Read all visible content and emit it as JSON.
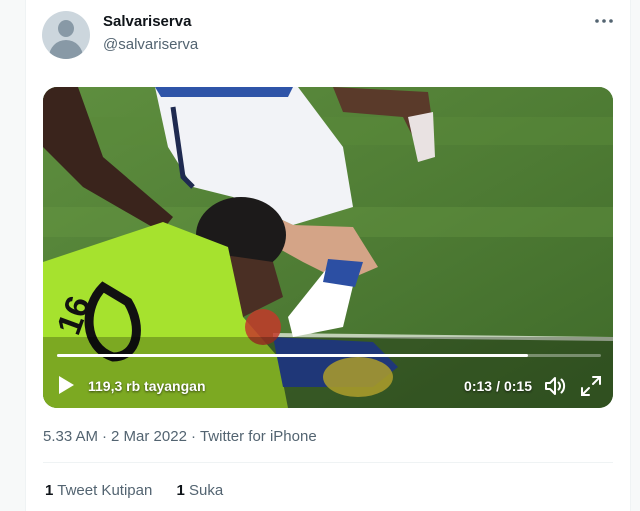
{
  "user": {
    "display_name": "Salvariserva",
    "handle": "@salvariserva",
    "avatar": "default-avatar-icon"
  },
  "actions": {
    "more": "more-options-icon"
  },
  "video": {
    "views": "119,3 rb tayangan",
    "current_time": "0:13",
    "separator": "/",
    "duration": "0:15",
    "progress_fraction": 0.865,
    "icons": {
      "play": "play-icon",
      "volume": "volume-icon",
      "fullscreen": "fullscreen-icon"
    }
  },
  "meta": {
    "time": "5.33 AM",
    "date": "2 Mar 2022",
    "source": "Twitter for iPhone",
    "separator": "·"
  },
  "stats": [
    {
      "count": "1",
      "label": "Tweet Kutipan"
    },
    {
      "count": "1",
      "label": "Suka"
    }
  ],
  "colors": {
    "text": "#0f1419",
    "muted": "#536471",
    "divider": "#eff3f4",
    "keeper_kit": "#a6e22e"
  }
}
